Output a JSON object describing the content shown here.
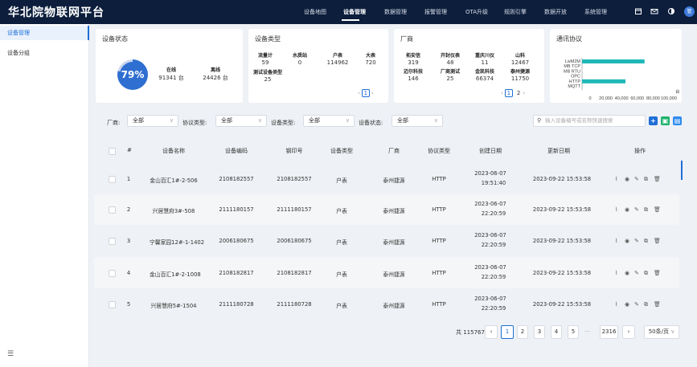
{
  "header": {
    "logo": "华北院物联网平台",
    "nav": [
      "设备地图",
      "设备管理",
      "数据管理",
      "报警管理",
      "OTA升级",
      "规则引擎",
      "数据开放",
      "系统管理"
    ],
    "active_nav": "设备管理",
    "avatar_text": "管"
  },
  "sidebar": {
    "items": [
      {
        "label": "设备管理",
        "active": true
      },
      {
        "label": "设备分组",
        "active": false
      }
    ]
  },
  "device_status": {
    "title": "设备状态",
    "percent": "79%",
    "online_label": "在线",
    "online_value": "91341 台",
    "offline_label": "离线",
    "offline_value": "24426 台"
  },
  "device_type": {
    "title": "设备类型",
    "stats": [
      {
        "label": "流量计",
        "value": "59"
      },
      {
        "label": "水质站",
        "value": "0"
      },
      {
        "label": "户表",
        "value": "114962"
      },
      {
        "label": "大表",
        "value": "720"
      },
      {
        "label": "测试设备类型",
        "value": "25"
      }
    ],
    "page": "1"
  },
  "vendor": {
    "title": "厂商",
    "stats": [
      {
        "label": "拓安信",
        "value": "319"
      },
      {
        "label": "开封仪表",
        "value": "48"
      },
      {
        "label": "重庆川仪",
        "value": "11"
      },
      {
        "label": "山科",
        "value": "12467"
      },
      {
        "label": "迈尔科技",
        "value": "146"
      },
      {
        "label": "厂商测试",
        "value": "25"
      },
      {
        "label": "金凯科技",
        "value": "66374"
      },
      {
        "label": "泰州捷源",
        "value": "11750"
      }
    ],
    "page": "1",
    "page_next": "2"
  },
  "protocol": {
    "title": "通讯协议",
    "labels": [
      "LwM2M",
      "MB TCP",
      "MB RTU",
      "OPC",
      "HTTP",
      "MQTT"
    ],
    "values": [
      72000,
      0,
      0,
      0,
      50000,
      100
    ],
    "xticks": [
      "0",
      "20,000",
      "40,000",
      "60,000",
      "80,000",
      "100,000"
    ],
    "x_extra": "台",
    "bar_color": "#1fb8b8"
  },
  "filters": {
    "vendor_label": "厂商:",
    "vendor_value": "全部",
    "protocol_label": "协议类型:",
    "protocol_value": "全部",
    "type_label": "设备类型:",
    "type_value": "全部",
    "status_label": "设备状态:",
    "status_value": "全部",
    "search_placeholder": "输入设备编号或名称快速搜索"
  },
  "table": {
    "headers": [
      "#",
      "设备名称",
      "设备编码",
      "钢印号",
      "设备类型",
      "厂商",
      "协议类型",
      "创建日期",
      "更新日期",
      "操作"
    ],
    "rows": [
      {
        "no": "1",
        "name": "金山百汇1#-2-506",
        "code": "2108182557",
        "seal": "2108182557",
        "type": "户表",
        "vendor": "泰州捷源",
        "protocol": "HTTP",
        "created_date": "2023-06-07",
        "created_time": "19:51:40",
        "updated": "2023-09-22 15:53:58"
      },
      {
        "no": "2",
        "name": "兴居慧府3#-508",
        "code": "2111180157",
        "seal": "2111180157",
        "type": "户表",
        "vendor": "泰州捷源",
        "protocol": "HTTP",
        "created_date": "2023-06-07",
        "created_time": "22:20:59",
        "updated": "2023-09-22 15:53:58"
      },
      {
        "no": "3",
        "name": "宁馨家园12#-1-1402",
        "code": "2006180675",
        "seal": "2006180675",
        "type": "户表",
        "vendor": "泰州捷源",
        "protocol": "HTTP",
        "created_date": "2023-06-07",
        "created_time": "22:20:59",
        "updated": "2023-09-22 15:53:58"
      },
      {
        "no": "4",
        "name": "金山百汇1#-2-1008",
        "code": "2108182817",
        "seal": "2108182817",
        "type": "户表",
        "vendor": "泰州捷源",
        "protocol": "HTTP",
        "created_date": "2023-06-07",
        "created_time": "22:20:59",
        "updated": "2023-09-22 15:53:58"
      },
      {
        "no": "5",
        "name": "兴居慧府5#-1504",
        "code": "2111180728",
        "seal": "2111180728",
        "type": "户表",
        "vendor": "泰州捷源",
        "protocol": "HTTP",
        "created_date": "2023-06-07",
        "created_time": "22:20:59",
        "updated": "2023-09-22 15:53:58"
      }
    ]
  },
  "pagination": {
    "total": "共 115767 台",
    "pages": [
      "1",
      "2",
      "3",
      "4",
      "5"
    ],
    "ellipsis": "···",
    "last": "2316",
    "page_size": "50条/页"
  }
}
